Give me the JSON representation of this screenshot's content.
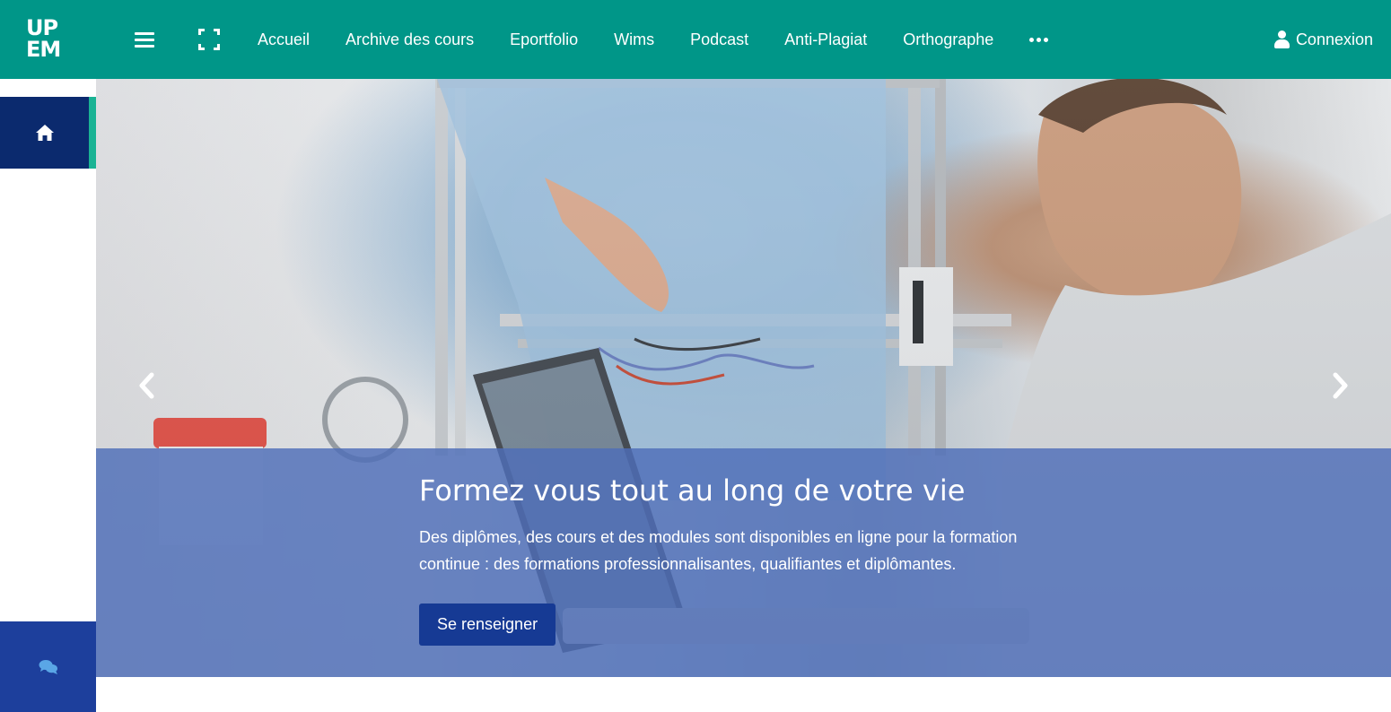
{
  "brand": {
    "logo_line1": "UP",
    "logo_line2": "EM",
    "accent": "#009688"
  },
  "nav": {
    "items": [
      "Accueil",
      "Archive des cours",
      "Eportfolio",
      "Wims",
      "Podcast",
      "Anti-Plagiat",
      "Orthographe"
    ],
    "more_icon": "ellipsis-icon",
    "menu_icon": "hamburger-icon",
    "fullscreen_icon": "fullscreen-icon",
    "login_label": "Connexion",
    "login_icon": "user-icon"
  },
  "sidebar": {
    "home_icon": "home-icon",
    "chat_icon": "chat-icon",
    "active_color": "#0b2a6e"
  },
  "hero": {
    "title": "Formez vous tout au long de votre vie",
    "description": "Des diplômes, des cours et des modules sont disponibles en ligne pour la formation continue : des formations professionnalisantes, qualifiantes et diplômantes.",
    "button_label": "Se renseigner",
    "prev_icon": "chevron-left-icon",
    "next_icon": "chevron-right-icon"
  }
}
